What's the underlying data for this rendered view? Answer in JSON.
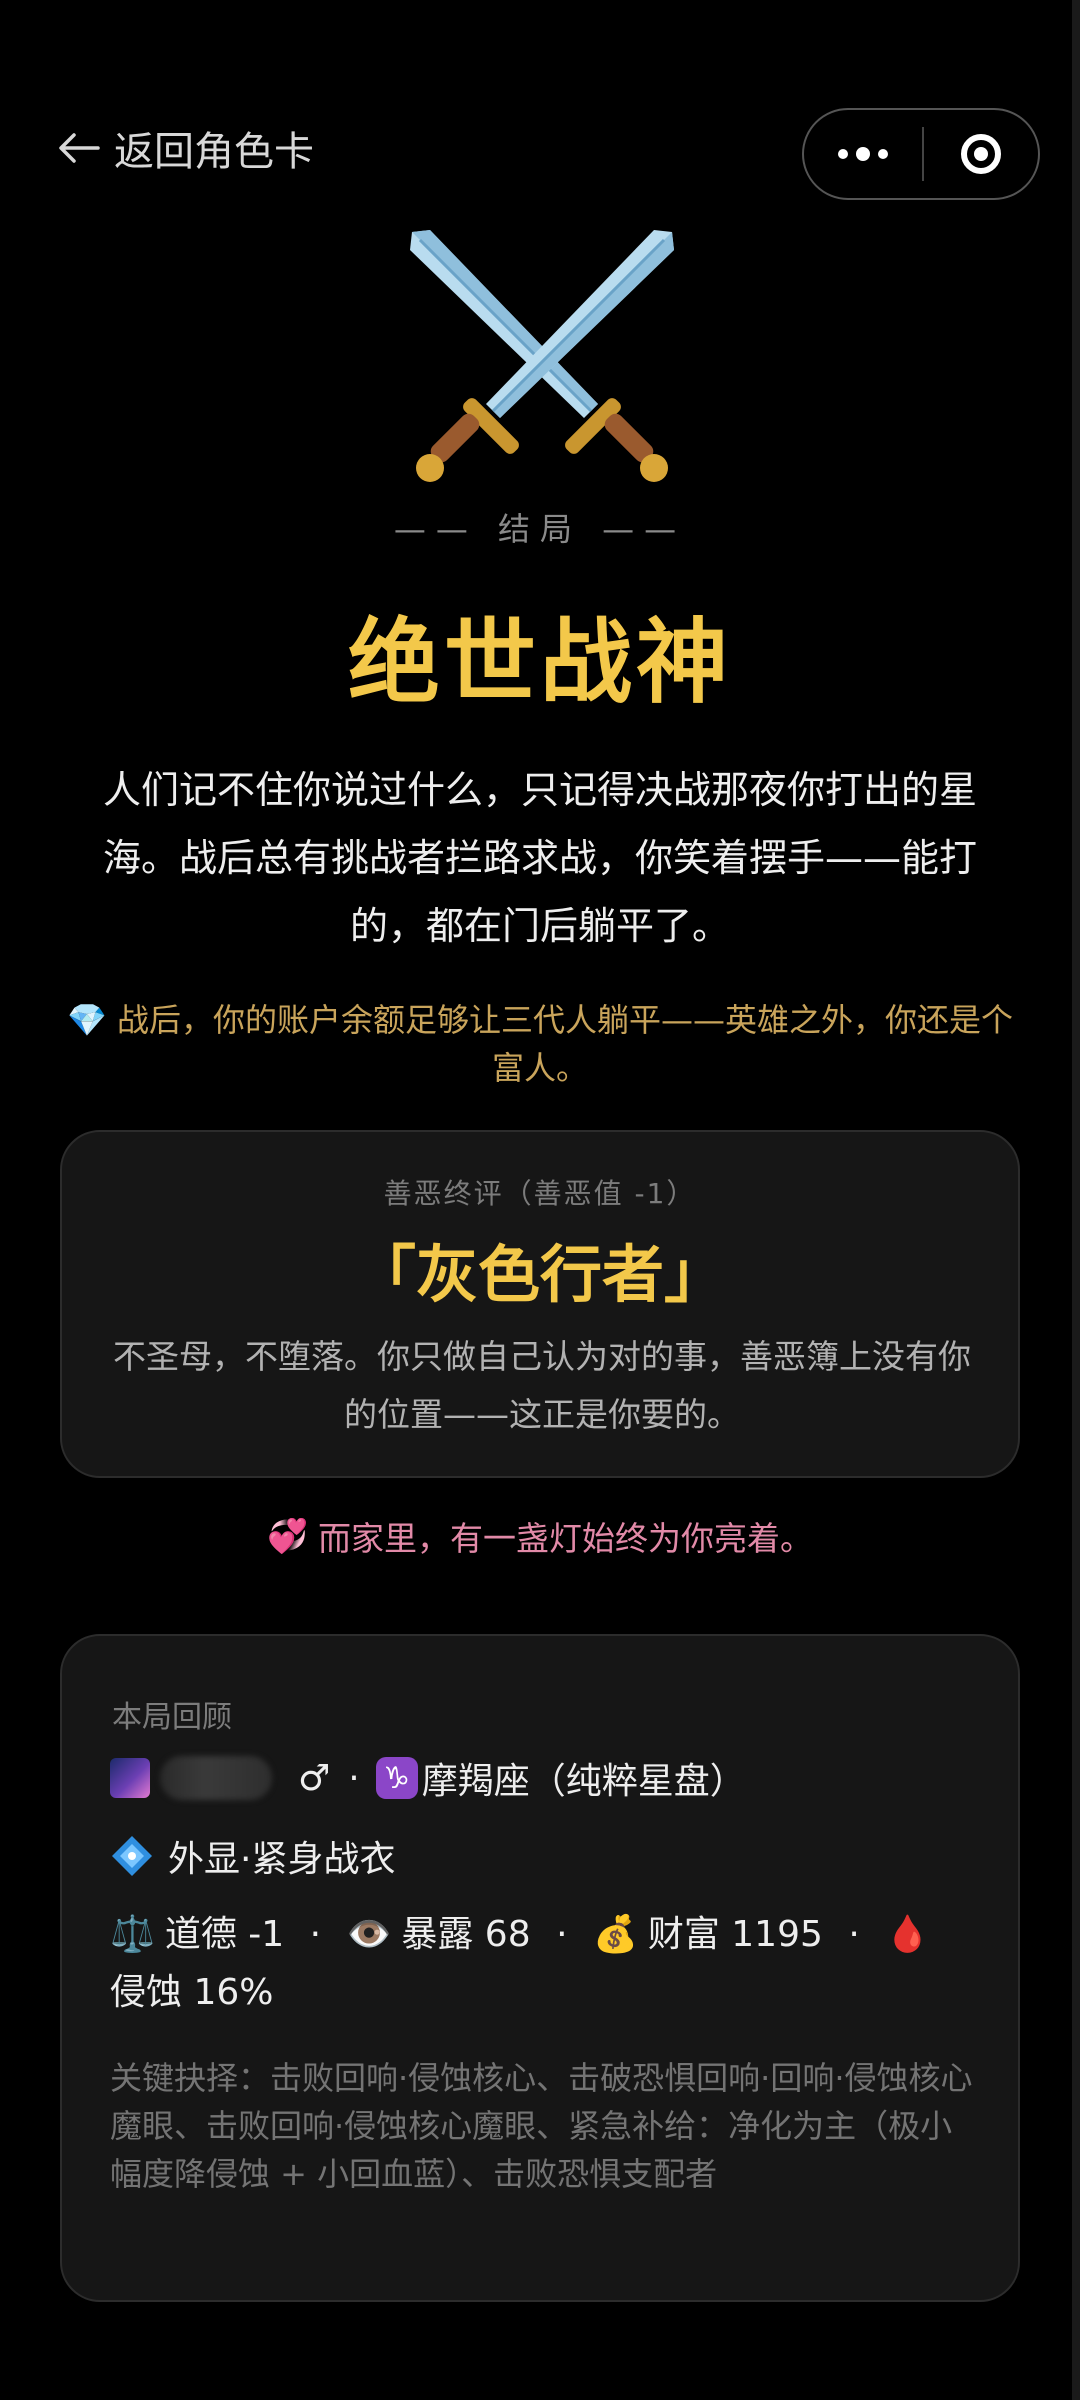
{
  "header": {
    "back_label": "返回角色卡",
    "more_icon": "more-dots-icon",
    "close_icon": "target-close-icon"
  },
  "hero": {
    "icon": "crossed-swords-icon",
    "ending_label": "—— 结局 ——",
    "title": "绝世战神",
    "description": "人们记不住你说过什么，只记得决战那夜你打出的星海。战后总有挑战者拦路求战，你笑着摆手——能打的，都在门后躺平了。",
    "wealth_note_emoji": "💎",
    "wealth_note": "战后，你的账户余额足够让三代人躺平——英雄之外，你还是个富人。"
  },
  "morality": {
    "label": "善恶终评（善恶值 -1）",
    "title": "「灰色行者」",
    "description": "不圣母，不堕落。你只做自己认为对的事，善恶簿上没有你的位置——这正是你要的。"
  },
  "family_note": {
    "emoji": "💞",
    "text": "而家里，有一盏灯始终为你亮着。"
  },
  "recap": {
    "label": "本局回顾",
    "identity": {
      "gender_symbol": "♂",
      "separator": "·",
      "zodiac_symbol": "♑",
      "zodiac_text": "摩羯座（纯粹星盘）"
    },
    "appearance": "外显·紧身战衣",
    "stats": {
      "morality_emoji": "⚖️",
      "morality": "道德 -1",
      "exposure_emoji": "👁️",
      "exposure": "暴露 68",
      "wealth_emoji": "💰",
      "wealth": "财富 1195",
      "corrosion_emoji": "🩸",
      "corrosion": "侵蚀 16%",
      "separator": "·"
    },
    "key_choices": "关键抉择：击败回响·侵蚀核心、击破恐惧回响·回响·侵蚀核心魔眼、击败回响·侵蚀核心魔眼、紧急补给：净化为主（极小幅度降侵蚀 + 小回血蓝）、击败恐惧支配者"
  },
  "colors": {
    "gold": "#f3c84a",
    "muted_gold": "#c9a45b",
    "pink": "#e28aa8",
    "card_bg": "#161616"
  }
}
